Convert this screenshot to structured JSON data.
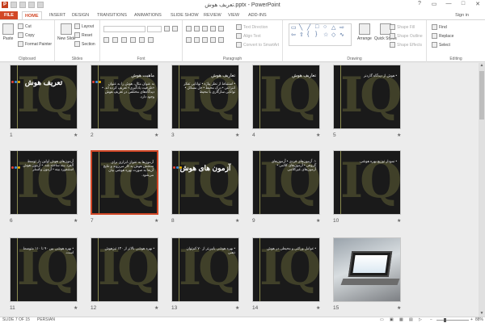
{
  "window": {
    "title": "تعریف هوش.pptx - PowerPoint",
    "controls": [
      "?",
      "▭",
      "—",
      "□",
      "✕"
    ]
  },
  "tabs": [
    "FILE",
    "HOME",
    "INSERT",
    "DESIGN",
    "TRANSITIONS",
    "ANIMATIONS",
    "SLIDE SHOW",
    "REVIEW",
    "VIEW",
    "ADD-INS"
  ],
  "signin": "Sign in",
  "ribbon": {
    "clipboard": {
      "label": "Clipboard",
      "paste": "Paste",
      "cut": "Cut",
      "copy": "Copy",
      "format_painter": "Format Painter"
    },
    "slides": {
      "label": "Slides",
      "new_slide": "New Slide",
      "layout": "Layout",
      "reset": "Reset",
      "section": "Section"
    },
    "font": {
      "label": "Font"
    },
    "paragraph": {
      "label": "Paragraph",
      "text_direction": "Text Direction",
      "align_text": "Align Text",
      "convert_smartart": "Convert to SmartArt"
    },
    "drawing": {
      "label": "Drawing",
      "arrange": "Arrange",
      "quick_styles": "Quick Styles",
      "shape_fill": "Shape Fill",
      "shape_outline": "Shape Outline",
      "shape_effects": "Shape Effects"
    },
    "editing": {
      "label": "Editing",
      "find": "Find",
      "replace": "Replace",
      "select": "Select"
    }
  },
  "slides": [
    {
      "num": "1",
      "title": "تعریف هوش",
      "type": "title",
      "dots": [
        "#e9443c",
        "#3b8fe0",
        "#f0b400"
      ]
    },
    {
      "num": "2",
      "title": "ماهیت هوش",
      "type": "text",
      "body": "به عنوان مثال، هوش را به عنوان «ظرفیت یادگیری» تعریف کرده اند. • دیدگاه‌های مختلفی در تعریف هوش وجود دارد.",
      "dots": [
        "#e9443c",
        "#3b8fe0",
        "#f0b400"
      ]
    },
    {
      "num": "3",
      "title": "تعاریف هوش",
      "type": "text",
      "body": "• استنباط از نظر پیاژه • توانایی تفکر انتزاعی • درک محیط • حل مسائل • توانایی سازگاری با محیط",
      "dots": []
    },
    {
      "num": "4",
      "title": "تعاریف هوش",
      "type": "text",
      "body": "",
      "dots": []
    },
    {
      "num": "5",
      "title": "",
      "type": "text",
      "body": "• هوش از دیدگاه گاردنر",
      "dots": []
    },
    {
      "num": "6",
      "title": "",
      "type": "text",
      "body": "آزمون‌های هوش اولین بار توسط آلفرد بینه ساخته شد. • آزمون هوش استنفورد بینه • آزمون وکسلر",
      "dots": [
        "#e9443c",
        "#3b8fe0",
        "#f0b400"
      ]
    },
    {
      "num": "7",
      "title": "",
      "type": "text",
      "body": "آزمون‌ها به عنوان ابزاری برای سنجش هوش به کار می‌روند و نتایج آن‌ها به صورت بهره هوشی بیان می‌شود.",
      "dots": [],
      "selected": true
    },
    {
      "num": "8",
      "title": "آزمون های هوش",
      "type": "title",
      "dots": [
        "#e9443c",
        "#3b8fe0",
        "#f0b400"
      ]
    },
    {
      "num": "9",
      "title": "",
      "type": "text",
      "body": "۱. آزمون‌های فردی • آزمون‌های گروهی • آزمون‌های کلامی • آزمون‌های غیرکلامی",
      "dots": []
    },
    {
      "num": "10",
      "title": "",
      "type": "text",
      "body": "• نمودار توزیع بهره هوشی",
      "dots": []
    },
    {
      "num": "11",
      "title": "",
      "type": "text",
      "body": "• بهره هوشی بین ۹۰ تا ۱۱۰ متوسط است.",
      "dots": []
    },
    {
      "num": "12",
      "title": "",
      "type": "text",
      "body": "• بهره هوشی بالاتر از ۱۳۰ تیزهوش",
      "dots": []
    },
    {
      "num": "13",
      "title": "",
      "type": "text",
      "body": "• بهره هوشی پایین‌تر از ۷۰ کم‌توان ذهنی",
      "dots": []
    },
    {
      "num": "14",
      "title": "",
      "type": "text",
      "body": "• عوامل وراثتی و محیطی در هوش",
      "dots": []
    },
    {
      "num": "15",
      "title": "",
      "type": "photo",
      "dots": []
    }
  ],
  "status": {
    "slide_info": "SLIDE 7 OF 15",
    "language": "PERSIAN",
    "zoom": "88%"
  }
}
